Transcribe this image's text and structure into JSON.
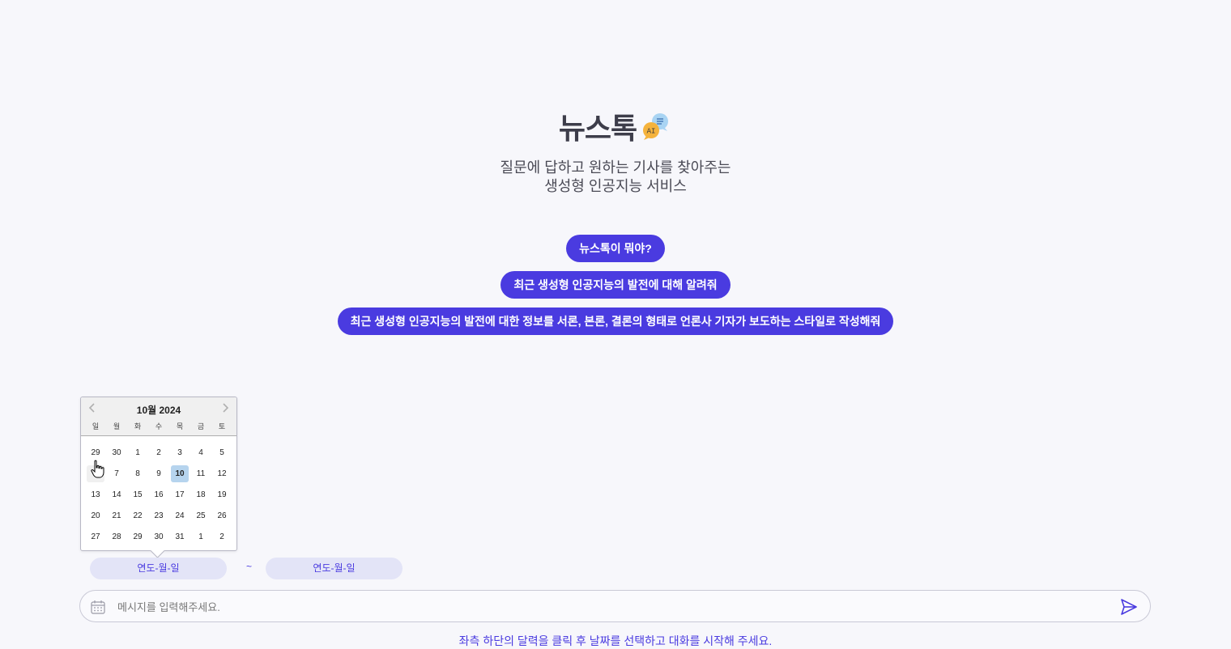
{
  "header": {
    "title": "뉴스톡",
    "badge": "AI",
    "subtitle_line1": "질문에 답하고 원하는 기사를 찾아주는",
    "subtitle_line2": "생성형 인공지능 서비스"
  },
  "suggestions": [
    {
      "label": "뉴스톡이 뭐야?"
    },
    {
      "label": "최근 생성형 인공지능의 발전에 대해 알려줘"
    },
    {
      "label": "최근 생성형 인공지능의 발전에 대한 정보를 서론, 본론, 결론의 형태로 언론사 기자가 보도하는 스타일로 작성해줘"
    }
  ],
  "calendar": {
    "month_label": "10월 2024",
    "weekdays": [
      "일",
      "월",
      "화",
      "수",
      "목",
      "금",
      "토"
    ],
    "weeks": [
      [
        "29",
        "30",
        "1",
        "2",
        "3",
        "4",
        "5"
      ],
      [
        "6",
        "7",
        "8",
        "9",
        "10",
        "11",
        "12"
      ],
      [
        "13",
        "14",
        "15",
        "16",
        "17",
        "18",
        "19"
      ],
      [
        "20",
        "21",
        "22",
        "23",
        "24",
        "25",
        "26"
      ],
      [
        "27",
        "28",
        "29",
        "30",
        "31",
        "1",
        "2"
      ]
    ],
    "selected_day": "10"
  },
  "date_range": {
    "from_placeholder": "연도-월-일",
    "separator": "~",
    "to_placeholder": "연도-월-일"
  },
  "message": {
    "placeholder": "메시지를 입력해주세요."
  },
  "hint": "좌측 하단의 달력을 클릭 후 날짜를 선택하고 대화를 시작해 주세요.",
  "colors": {
    "accent": "#4a3be0",
    "background": "#f7f7fb",
    "selected_day": "#b6d4ee",
    "date_input_bg": "#e3e4f7"
  },
  "icons": {
    "logo": "ai-chat-bubble-icon",
    "calendar": "calendar-icon",
    "send": "send-icon",
    "prev": "chevron-left-icon",
    "next": "chevron-right-icon"
  }
}
